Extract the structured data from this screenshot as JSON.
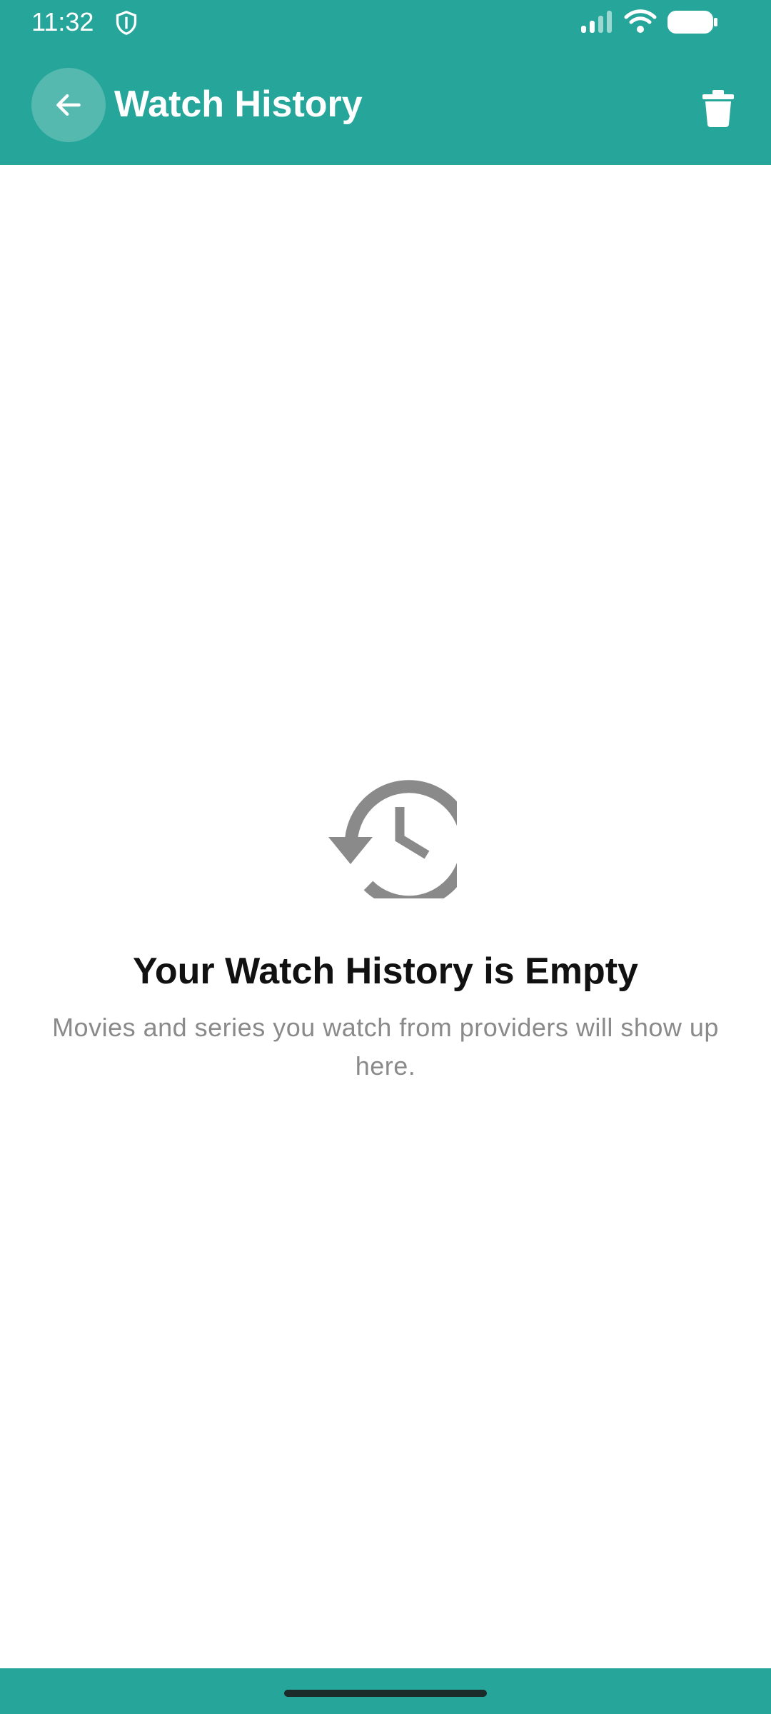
{
  "status_bar": {
    "time": "11:32",
    "icons": [
      "shield-icon",
      "cellular-signal-icon",
      "wifi-icon",
      "battery-icon"
    ]
  },
  "app_bar": {
    "title": "Watch History",
    "back_icon": "arrow-left-icon",
    "action_icon": "trash-icon"
  },
  "empty_state": {
    "icon": "history-icon",
    "title": "Your Watch History is Empty",
    "subtitle": "Movies and series you watch from providers will show up here."
  },
  "colors": {
    "primary": "#26a69a",
    "icon_gray": "#8a8a8a",
    "title_text": "#111111",
    "subtitle_text": "#8a8a8a"
  }
}
